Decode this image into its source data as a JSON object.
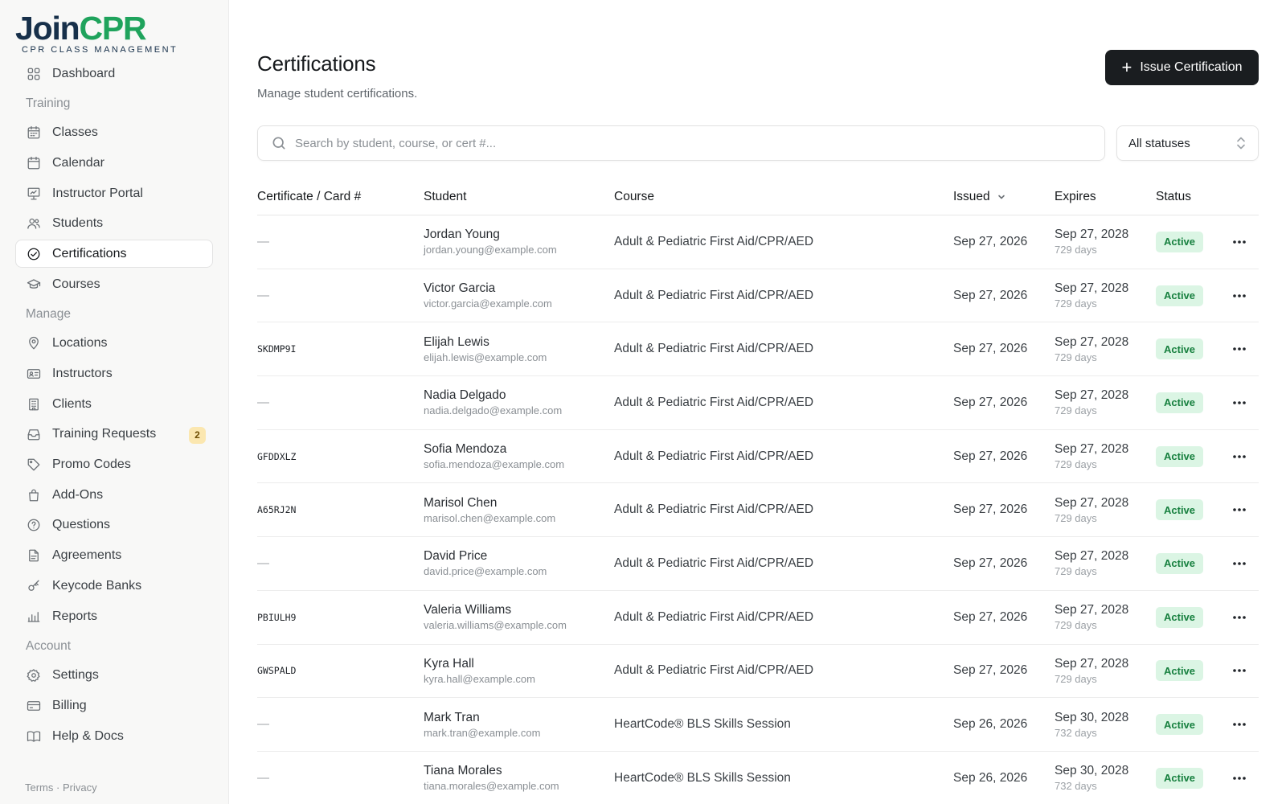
{
  "brand": {
    "name_part1": "Join",
    "name_part2": "CPR",
    "tagline": "CPR CLASS MANAGEMENT",
    "colors": {
      "navy": "#17304a",
      "green": "#1fa35c"
    }
  },
  "sidebar": {
    "items": [
      {
        "type": "item",
        "label": "Dashboard",
        "icon": "grid-icon",
        "name": "dashboard"
      },
      {
        "type": "section",
        "label": "Training"
      },
      {
        "type": "item",
        "label": "Classes",
        "icon": "calendar-grid-icon",
        "name": "classes"
      },
      {
        "type": "item",
        "label": "Calendar",
        "icon": "calendar-icon",
        "name": "calendar"
      },
      {
        "type": "item",
        "label": "Instructor Portal",
        "icon": "presentation-icon",
        "name": "instructor-portal"
      },
      {
        "type": "item",
        "label": "Students",
        "icon": "users-icon",
        "name": "students"
      },
      {
        "type": "item",
        "label": "Certifications",
        "icon": "check-circle-icon",
        "name": "certifications",
        "active": true
      },
      {
        "type": "item",
        "label": "Courses",
        "icon": "graduation-cap-icon",
        "name": "courses"
      },
      {
        "type": "section",
        "label": "Manage"
      },
      {
        "type": "item",
        "label": "Locations",
        "icon": "map-pin-icon",
        "name": "locations"
      },
      {
        "type": "item",
        "label": "Instructors",
        "icon": "id-card-icon",
        "name": "instructors"
      },
      {
        "type": "item",
        "label": "Clients",
        "icon": "building-icon",
        "name": "clients"
      },
      {
        "type": "item",
        "label": "Training Requests",
        "icon": "inbox-icon",
        "name": "training-requests",
        "badge": "2"
      },
      {
        "type": "item",
        "label": "Promo Codes",
        "icon": "tag-icon",
        "name": "promo-codes"
      },
      {
        "type": "item",
        "label": "Add-Ons",
        "icon": "shopping-bag-icon",
        "name": "add-ons"
      },
      {
        "type": "item",
        "label": "Questions",
        "icon": "help-circle-icon",
        "name": "questions"
      },
      {
        "type": "item",
        "label": "Agreements",
        "icon": "file-text-icon",
        "name": "agreements"
      },
      {
        "type": "item",
        "label": "Keycode Banks",
        "icon": "key-icon",
        "name": "keycode-banks"
      },
      {
        "type": "item",
        "label": "Reports",
        "icon": "bar-chart-icon",
        "name": "reports"
      },
      {
        "type": "section",
        "label": "Account"
      },
      {
        "type": "item",
        "label": "Settings",
        "icon": "gear-icon",
        "name": "settings"
      },
      {
        "type": "item",
        "label": "Billing",
        "icon": "credit-card-icon",
        "name": "billing"
      },
      {
        "type": "item",
        "label": "Help & Docs",
        "icon": "book-icon",
        "name": "help-docs"
      }
    ],
    "footer": {
      "terms": "Terms",
      "separator": " · ",
      "privacy": "Privacy"
    }
  },
  "page": {
    "title": "Certifications",
    "subtitle": "Manage student certifications.",
    "issue_button": "Issue Certification"
  },
  "filters": {
    "search_placeholder": "Search by student, course, or cert #...",
    "status_value": "All statuses"
  },
  "table": {
    "columns": {
      "cert": "Certificate / Card #",
      "student": "Student",
      "course": "Course",
      "issued": "Issued",
      "expires": "Expires",
      "status": "Status"
    },
    "status_color": "#17803f",
    "rows": [
      {
        "cert": "—",
        "name": "Jordan Young",
        "email": "jordan.young@example.com",
        "course": "Adult & Pediatric First Aid/CPR/AED",
        "issued": "Sep 27, 2026",
        "expires": "Sep 27, 2028",
        "days": "729 days",
        "status": "Active"
      },
      {
        "cert": "—",
        "name": "Victor Garcia",
        "email": "victor.garcia@example.com",
        "course": "Adult & Pediatric First Aid/CPR/AED",
        "issued": "Sep 27, 2026",
        "expires": "Sep 27, 2028",
        "days": "729 days",
        "status": "Active"
      },
      {
        "cert": "SKDMP9I",
        "name": "Elijah Lewis",
        "email": "elijah.lewis@example.com",
        "course": "Adult & Pediatric First Aid/CPR/AED",
        "issued": "Sep 27, 2026",
        "expires": "Sep 27, 2028",
        "days": "729 days",
        "status": "Active"
      },
      {
        "cert": "—",
        "name": "Nadia Delgado",
        "email": "nadia.delgado@example.com",
        "course": "Adult & Pediatric First Aid/CPR/AED",
        "issued": "Sep 27, 2026",
        "expires": "Sep 27, 2028",
        "days": "729 days",
        "status": "Active"
      },
      {
        "cert": "GFDDXLZ",
        "name": "Sofia Mendoza",
        "email": "sofia.mendoza@example.com",
        "course": "Adult & Pediatric First Aid/CPR/AED",
        "issued": "Sep 27, 2026",
        "expires": "Sep 27, 2028",
        "days": "729 days",
        "status": "Active"
      },
      {
        "cert": "A65RJ2N",
        "name": "Marisol Chen",
        "email": "marisol.chen@example.com",
        "course": "Adult & Pediatric First Aid/CPR/AED",
        "issued": "Sep 27, 2026",
        "expires": "Sep 27, 2028",
        "days": "729 days",
        "status": "Active"
      },
      {
        "cert": "—",
        "name": "David Price",
        "email": "david.price@example.com",
        "course": "Adult & Pediatric First Aid/CPR/AED",
        "issued": "Sep 27, 2026",
        "expires": "Sep 27, 2028",
        "days": "729 days",
        "status": "Active"
      },
      {
        "cert": "PBIULH9",
        "name": "Valeria Williams",
        "email": "valeria.williams@example.com",
        "course": "Adult & Pediatric First Aid/CPR/AED",
        "issued": "Sep 27, 2026",
        "expires": "Sep 27, 2028",
        "days": "729 days",
        "status": "Active"
      },
      {
        "cert": "GWSPALD",
        "name": "Kyra Hall",
        "email": "kyra.hall@example.com",
        "course": "Adult & Pediatric First Aid/CPR/AED",
        "issued": "Sep 27, 2026",
        "expires": "Sep 27, 2028",
        "days": "729 days",
        "status": "Active"
      },
      {
        "cert": "—",
        "name": "Mark Tran",
        "email": "mark.tran@example.com",
        "course": "HeartCode® BLS Skills Session",
        "issued": "Sep 26, 2026",
        "expires": "Sep 30, 2028",
        "days": "732 days",
        "status": "Active"
      },
      {
        "cert": "—",
        "name": "Tiana Morales",
        "email": "tiana.morales@example.com",
        "course": "HeartCode® BLS Skills Session",
        "issued": "Sep 26, 2026",
        "expires": "Sep 30, 2028",
        "days": "732 days",
        "status": "Active"
      }
    ]
  }
}
